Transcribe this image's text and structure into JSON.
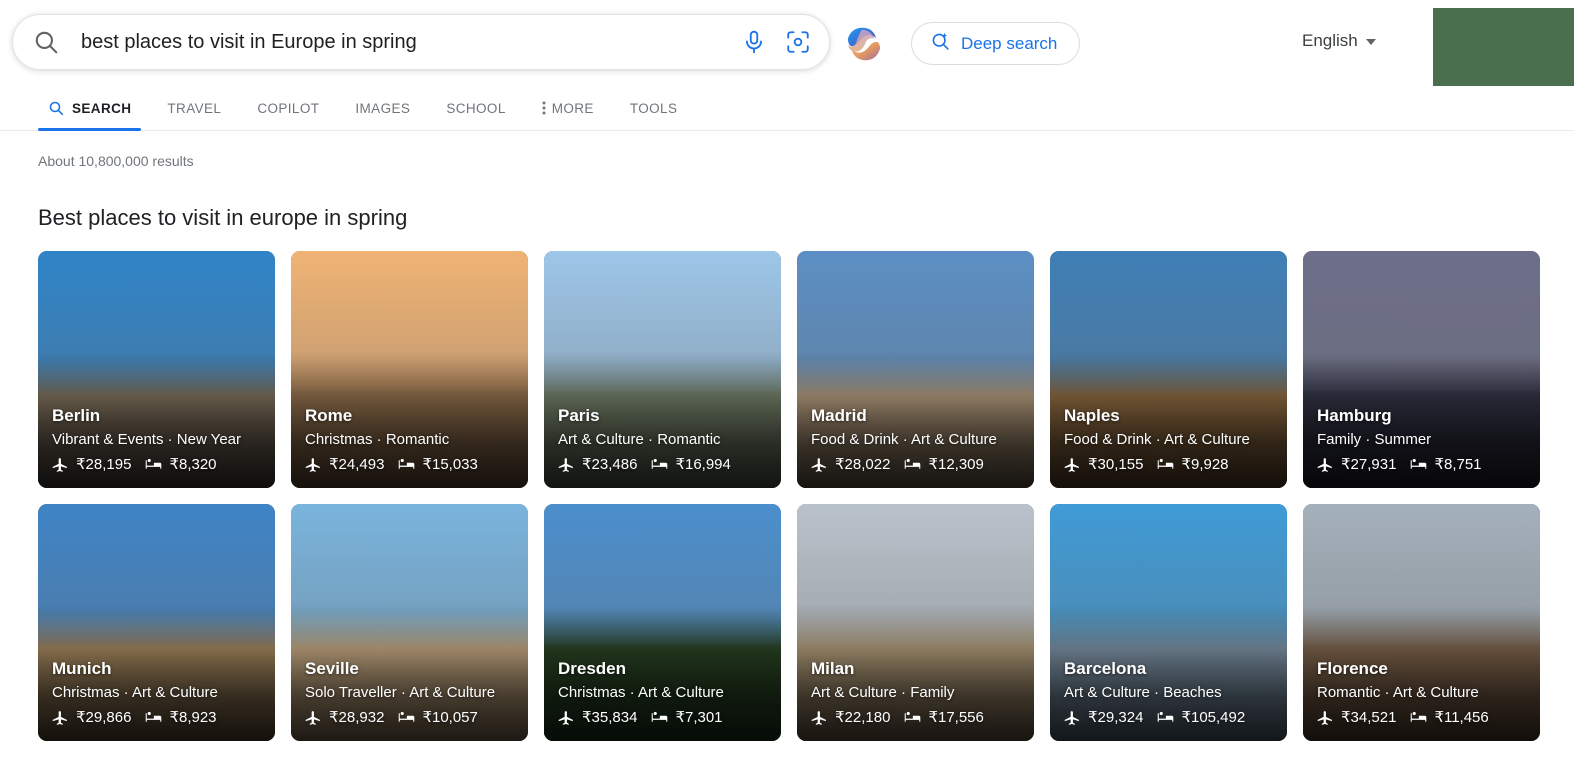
{
  "header": {
    "search": {
      "value": "best places to visit in Europe in spring",
      "placeholder": "Search",
      "search_icon": "search-icon",
      "mic_icon": "microphone-icon",
      "lens_icon": "camera-lens-icon"
    },
    "copilot_logo": "copilot-ribbon-icon",
    "deep_search": {
      "label": "Deep search",
      "icon": "deep-search-icon",
      "color": "#1a73e8"
    },
    "language": {
      "label": "English",
      "caret_icon": "chevron-down-icon"
    },
    "redacted_block_color": "#4a6f4e"
  },
  "nav": {
    "tabs": [
      {
        "label": "SEARCH",
        "icon": "search-icon",
        "active": true
      },
      {
        "label": "TRAVEL",
        "icon": "",
        "active": false
      },
      {
        "label": "COPILOT",
        "icon": "",
        "active": false
      },
      {
        "label": "IMAGES",
        "icon": "",
        "active": false
      },
      {
        "label": "SCHOOL",
        "icon": "",
        "active": false
      },
      {
        "label": "MORE",
        "icon": "vertical-dots-icon",
        "active": false
      },
      {
        "label": "TOOLS",
        "icon": "",
        "active": false
      }
    ],
    "active_color": "#1a73e8"
  },
  "results": {
    "count_text": "About 10,800,000 results",
    "section_title": "Best places to visit in europe in spring"
  },
  "cards": [
    {
      "city": "Berlin",
      "tags": "Vibrant & Events · New Year",
      "flight_price": "₹28,195",
      "hotel_price": "₹8,320",
      "sky": "#2f84c8",
      "ground": "#8a7a63",
      "dark": "#1b1b22"
    },
    {
      "city": "Rome",
      "tags": "Christmas · Romantic",
      "flight_price": "₹24,493",
      "hotel_price": "₹15,033",
      "sky": "#f0b374",
      "ground": "#9c7752",
      "dark": "#4a3a2c"
    },
    {
      "city": "Paris",
      "tags": "Art & Culture · Romantic",
      "flight_price": "₹23,486",
      "hotel_price": "₹16,994",
      "sky": "#9dc6e8",
      "ground": "#7d8a72",
      "dark": "#3c4435"
    },
    {
      "city": "Madrid",
      "tags": "Food & Drink · Art & Culture",
      "flight_price": "₹28,022",
      "hotel_price": "₹12,309",
      "sky": "#5b8fc4",
      "ground": "#c3a887",
      "dark": "#2b2720"
    },
    {
      "city": "Naples",
      "tags": "Food & Drink · Art & Culture",
      "flight_price": "₹30,155",
      "hotel_price": "₹9,928",
      "sky": "#3f7fb6",
      "ground": "#9a7346",
      "dark": "#3a2b1c"
    },
    {
      "city": "Hamburg",
      "tags": "Family · Summer",
      "flight_price": "₹27,931",
      "hotel_price": "₹8,751",
      "sky": "#6d6f8a",
      "ground": "#36384a",
      "dark": "#17181f"
    },
    {
      "city": "Munich",
      "tags": "Christmas · Art & Culture",
      "flight_price": "₹29,866",
      "hotel_price": "₹8,923",
      "sky": "#3f84c6",
      "ground": "#b59467",
      "dark": "#22231f"
    },
    {
      "city": "Seville",
      "tags": "Solo Traveller · Art & Culture",
      "flight_price": "₹28,932",
      "hotel_price": "₹10,057",
      "sky": "#79b4dd",
      "ground": "#d8b98e",
      "dark": "#5e4f3c"
    },
    {
      "city": "Dresden",
      "tags": "Christmas · Art & Culture",
      "flight_price": "₹35,834",
      "hotel_price": "₹7,301",
      "sky": "#4b8fcd",
      "ground": "#2f4a27",
      "dark": "#16301a"
    },
    {
      "city": "Milan",
      "tags": "Art & Culture · Family",
      "flight_price": "₹22,180",
      "hotel_price": "₹17,556",
      "sky": "#b9c2cb",
      "ground": "#c0a983",
      "dark": "#3a3026"
    },
    {
      "city": "Barcelona",
      "tags": "Art & Culture · Beaches",
      "flight_price": "₹29,324",
      "hotel_price": "₹105,492",
      "sky": "#3f9bd6",
      "ground": "#8aa0b4",
      "dark": "#3a4a55"
    },
    {
      "city": "Florence",
      "tags": "Romantic · Art & Culture",
      "flight_price": "₹34,521",
      "hotel_price": "₹11,456",
      "sky": "#a4b0bb",
      "ground": "#8a6d52",
      "dark": "#3e2e22"
    }
  ],
  "icons": {
    "flight": "airplane-icon",
    "hotel": "bed-icon"
  }
}
